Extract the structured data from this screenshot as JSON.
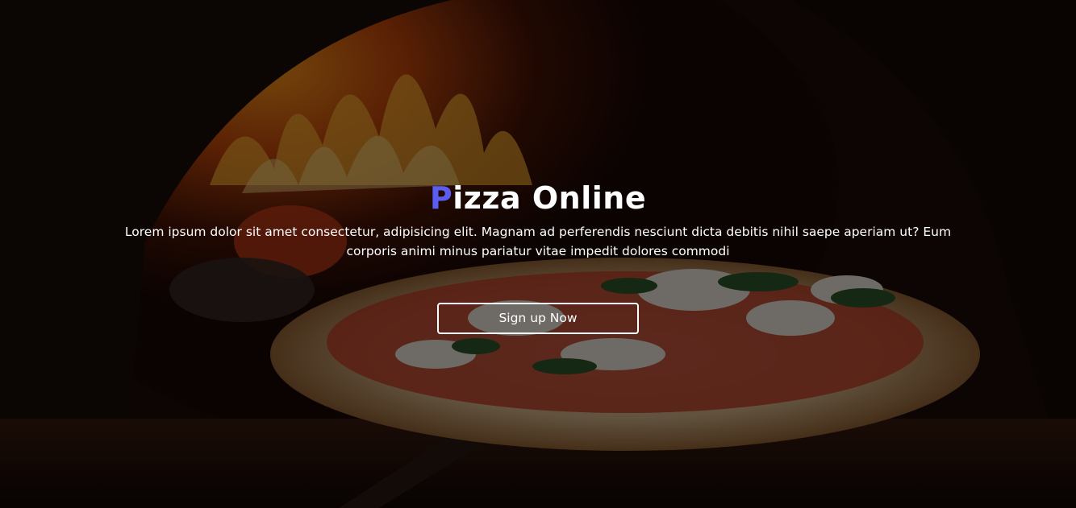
{
  "hero": {
    "title_first_letter": "P",
    "title_rest": "izza Online",
    "description": "Lorem ipsum dolor sit amet consectetur, adipisicing elit. Magnam ad perferendis nesciunt dicta debitis nihil saepe aperiam ut? Eum corporis animi minus pariatur vitae impedit dolores commodi",
    "cta_label": "Sign up Now",
    "background": "pizza-oven-photo"
  },
  "colors": {
    "accent": "#5b5cf0",
    "text": "#ffffff",
    "overlay": "rgba(0,0,0,0.55)"
  }
}
